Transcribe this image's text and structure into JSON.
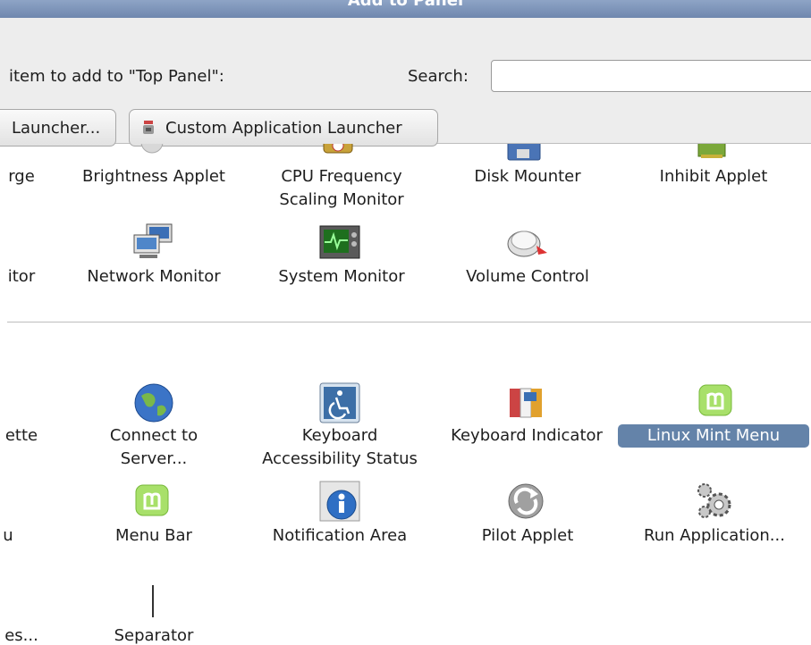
{
  "window": {
    "title": "Add to Panel"
  },
  "header": {
    "prompt": "item to add to \"Top Panel\":",
    "search_label": "Search:",
    "search_value": ""
  },
  "buttons": {
    "launcher": "Launcher...",
    "custom_launcher": "Custom Application Launcher"
  },
  "row1": {
    "partial": "rge",
    "brightness": "Brightness Applet",
    "cpu_line1": "CPU Frequency",
    "cpu_line2": "Scaling Monitor",
    "disk": "Disk Mounter",
    "inhibit": "Inhibit Applet"
  },
  "row2": {
    "partial": "itor",
    "network": "Network Monitor",
    "system": "System Monitor",
    "volume": "Volume Control"
  },
  "row3": {
    "partial": "ette",
    "connect_line1": "Connect to",
    "connect_line2": "Server...",
    "kbd_access_line1": "Keyboard",
    "kbd_access_line2": "Accessibility Status",
    "kbd_indicator": "Keyboard Indicator",
    "mint_menu": "Linux Mint Menu"
  },
  "row4": {
    "partial": "u",
    "menu_bar": "Menu Bar",
    "notification": "Notification Area",
    "pilot": "Pilot Applet",
    "run_app": "Run Application..."
  },
  "row5": {
    "partial": "es...",
    "separator": "Separator"
  }
}
